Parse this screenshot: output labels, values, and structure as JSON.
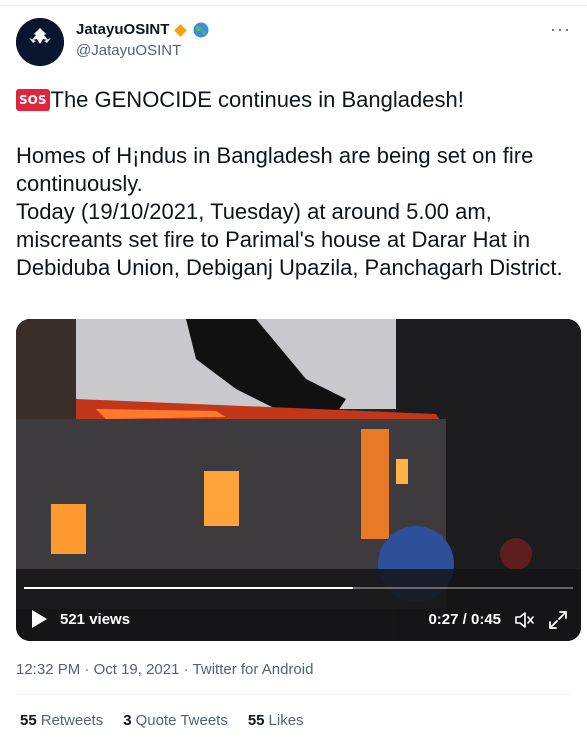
{
  "author": {
    "display_name": "JatayuOSINT",
    "handle": "@JatayuOSINT",
    "avatar_label": "JATAYU OSINT",
    "verified_badge": "orange-diamond-icon",
    "emoji_badge": "globe-icon"
  },
  "more_label": "···",
  "tweet": {
    "sos_label": "SOS",
    "line1": "The GENOCIDE continues in Bangladesh!",
    "para2_a": "Homes of H¡ndus in Bangladesh are being set on fire continuously.",
    "para2_b": "Today (19/10/2021, Tuesday) at around 5.00 am, miscreants set fire to Parimal's house at Darar Hat in Debiduba Union, Debiganj Upazila, Panchagarh District."
  },
  "video": {
    "views": "521 views",
    "time": "0:27 / 0:45",
    "progress_fraction": 0.6
  },
  "meta": {
    "time": "12:32 PM",
    "date": "Oct 19, 2021",
    "source": "Twitter for Android",
    "separator": "·"
  },
  "stats": {
    "retweets_count": "55",
    "retweets_label": "Retweets",
    "quotes_count": "3",
    "quotes_label": "Quote Tweets",
    "likes_count": "55",
    "likes_label": "Likes"
  },
  "colors": {
    "text": "#0f1419",
    "secondary": "#536471",
    "sos_red": "#e0243d",
    "badge_orange": "#f4a21a"
  }
}
